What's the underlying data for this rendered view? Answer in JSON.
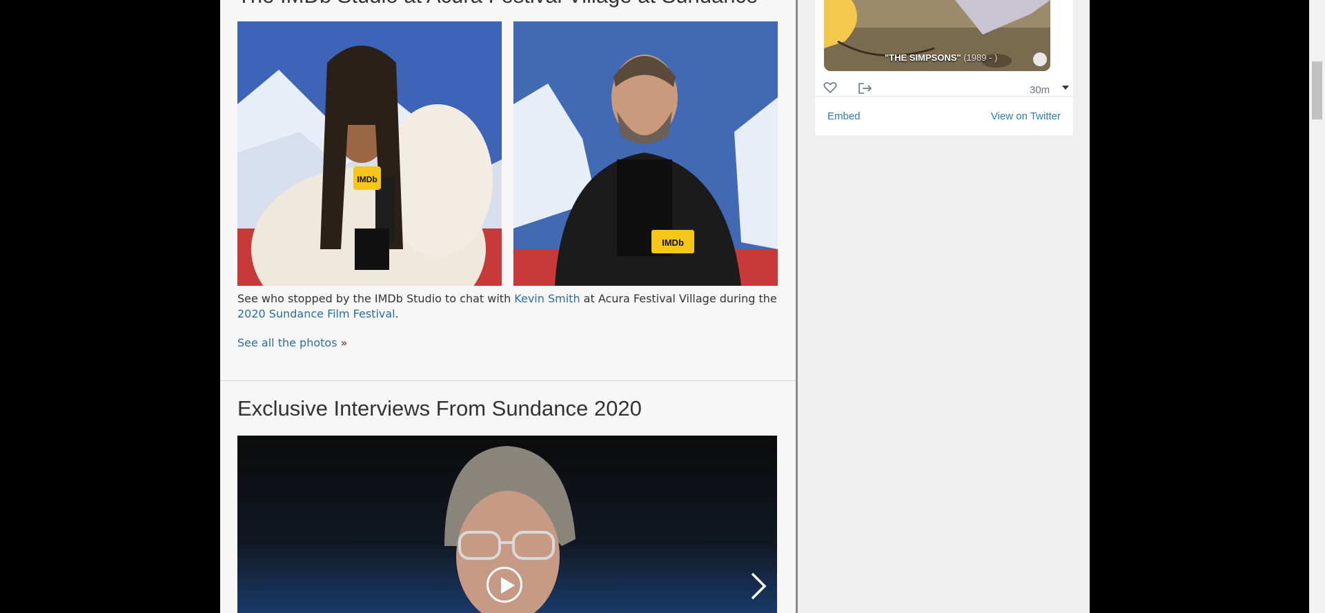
{
  "article": {
    "title": "The IMDb Studio at Acura Festival Village at Sundance",
    "caption": {
      "part1": "See who stopped by the IMDb Studio to chat with ",
      "link1": "Kevin Smith",
      "part2": " at Acura Festival Village during the ",
      "link2": "2020 Sundance Film Festival",
      "part3": "."
    },
    "see_all": {
      "link": "See all the photos",
      "suffix": " »"
    },
    "photos": [
      {
        "mic_label": "IMDb"
      },
      {
        "mic_label": "IMDb"
      }
    ]
  },
  "interviews": {
    "title": "Exclusive Interviews From Sundance 2020"
  },
  "twitter": {
    "image_caption_title": "\"THE SIMPSONS\"",
    "image_caption_years": " (1989 - )",
    "time": "30m",
    "embed_label": "Embed",
    "view_label": "View on Twitter"
  },
  "colors": {
    "link": "#2c6ea5",
    "twitter_link": "#2b7bb9",
    "imdb_yellow": "#f5c518"
  }
}
